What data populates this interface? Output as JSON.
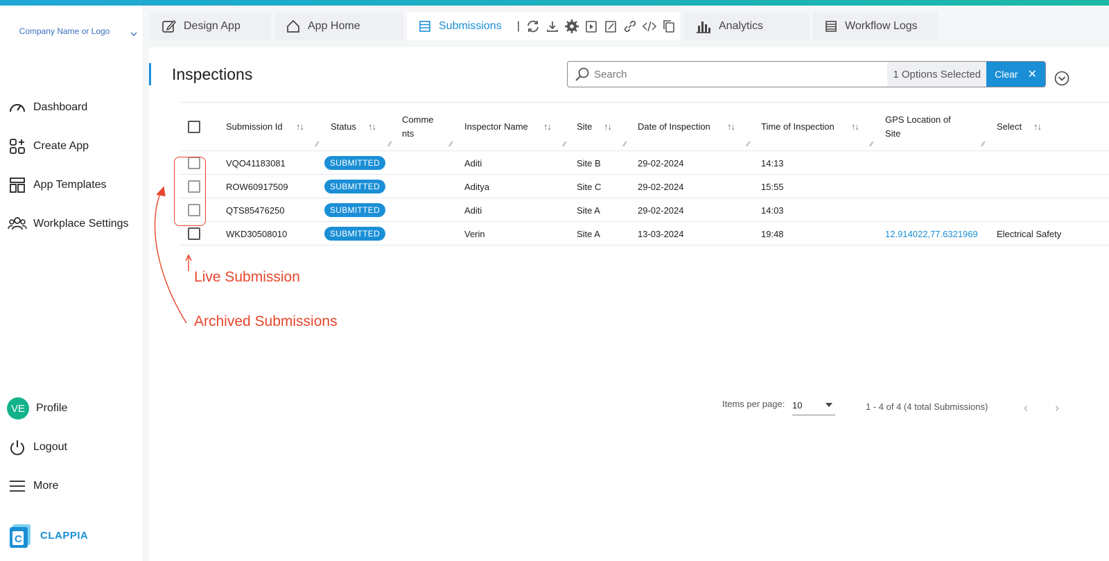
{
  "sidebar": {
    "company": "Company Name or Logo",
    "items": [
      {
        "label": "Dashboard",
        "icon": "gauge-icon"
      },
      {
        "label": "Create App",
        "icon": "grid-plus-icon"
      },
      {
        "label": "App Templates",
        "icon": "templates-icon"
      },
      {
        "label": "Workplace Settings",
        "icon": "users-icon"
      }
    ],
    "bottom": {
      "profile_initials": "VE",
      "profile_label": "Profile",
      "logout_label": "Logout",
      "more_label": "More"
    },
    "brand": "CLAPPIA"
  },
  "tabs": {
    "design": "Design App",
    "home": "App Home",
    "submissions": "Submissions",
    "analytics": "Analytics",
    "workflow": "Workflow Logs",
    "separator": "|"
  },
  "page": {
    "title": "Inspections"
  },
  "search": {
    "placeholder": "Search",
    "options_selected": "1 Options Selected",
    "clear_label": "Clear"
  },
  "table": {
    "columns": [
      "Submission Id",
      "Status",
      "Comments",
      "Inspector Name",
      "Site",
      "Date of Inspection",
      "Time of Inspection",
      "GPS Location of Site",
      "Select"
    ],
    "comments_header_line1": "Comme",
    "comments_header_line2": "nts",
    "gps_header_line1": "GPS Location of",
    "gps_header_line2": "Site",
    "rows": [
      {
        "id": "VQO41183081",
        "status": "SUBMITTED",
        "comments": "",
        "inspector": "Aditi",
        "site": "Site B",
        "date": "29-02-2024",
        "time": "14:13",
        "gps": "",
        "select": ""
      },
      {
        "id": "ROW60917509",
        "status": "SUBMITTED",
        "comments": "",
        "inspector": "Aditya",
        "site": "Site C",
        "date": "29-02-2024",
        "time": "15:55",
        "gps": "",
        "select": ""
      },
      {
        "id": "QTS85476250",
        "status": "SUBMITTED",
        "comments": "",
        "inspector": "Aditi",
        "site": "Site A",
        "date": "29-02-2024",
        "time": "14:03",
        "gps": "",
        "select": ""
      },
      {
        "id": "WKD30508010",
        "status": "SUBMITTED",
        "comments": "",
        "inspector": "Verin",
        "site": "Site A",
        "date": "13-03-2024",
        "time": "19:48",
        "gps": "12.914022,77.6321969",
        "select": "Electrical Safety"
      }
    ]
  },
  "annotations": {
    "live": "Live Submission",
    "archived": "Archived Submissions",
    "color": "#e8462c"
  },
  "pagination": {
    "items_per_page_label": "Items per page:",
    "items_per_page": "10",
    "range": "1 - 4 of 4 (4 total Submissions)"
  },
  "colors": {
    "accent": "#1a8fd6",
    "profile": "#13b28a"
  }
}
